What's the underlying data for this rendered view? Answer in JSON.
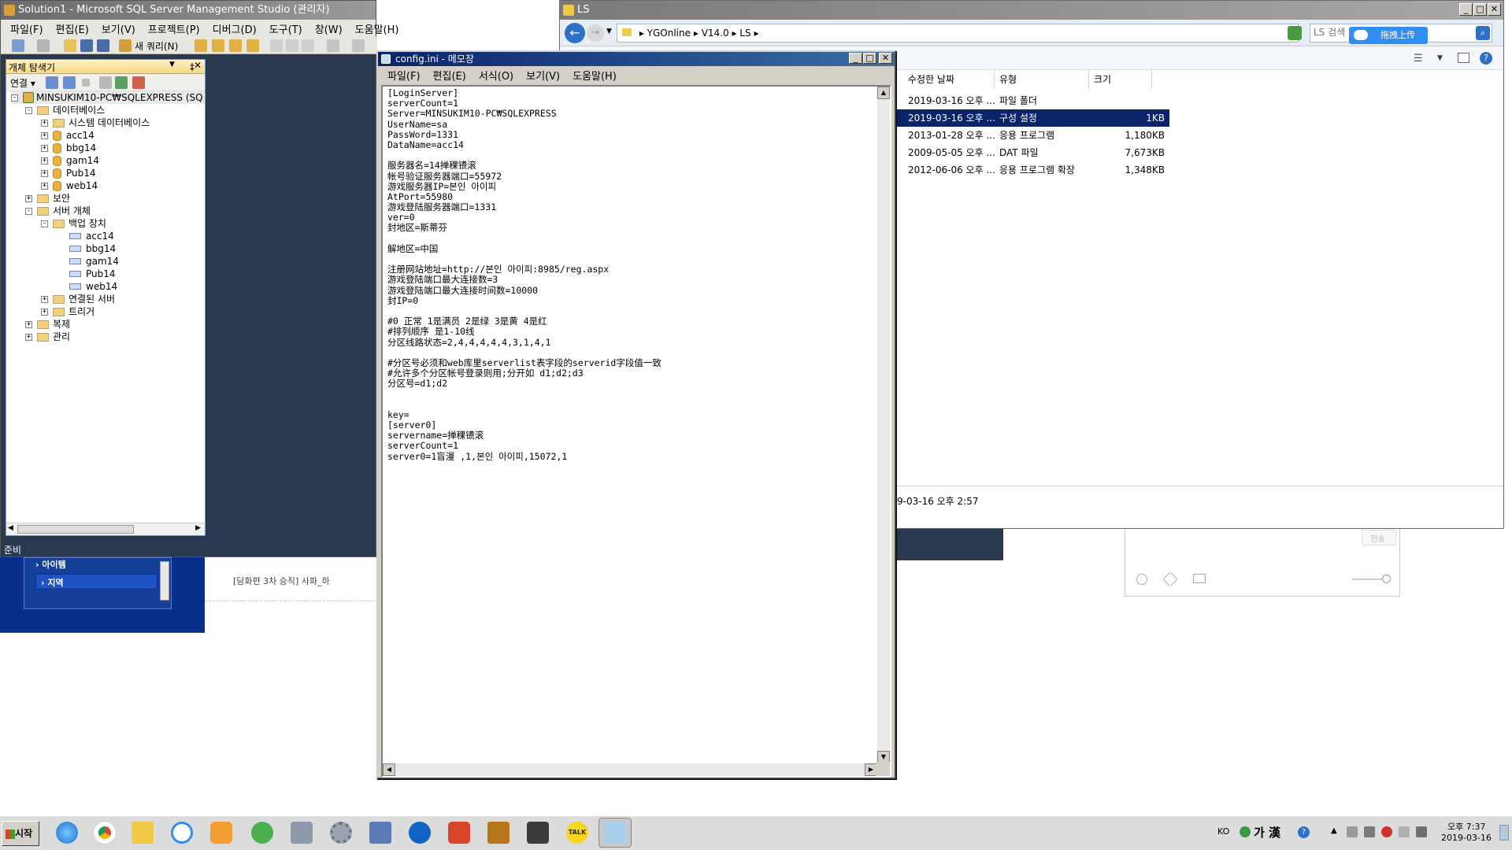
{
  "ssms": {
    "title": "Solution1 - Microsoft SQL Server Management Studio (관리자)",
    "menu": [
      "파일(F)",
      "편집(E)",
      "보기(V)",
      "프로젝트(P)",
      "디버그(D)",
      "도구(T)",
      "창(W)",
      "도움말(H)"
    ],
    "new_query_label": "새 쿼리(N)",
    "status": "준비",
    "object_explorer": {
      "title": "개체 탐색기",
      "pin": "ᅟ",
      "connect_label": "연결",
      "server": "MINSUKIM10-PC₩SQLEXPRESS (SQ",
      "nodes": {
        "databases": "데이터베이스",
        "system_databases": "시스템 데이터베이스",
        "dbs": [
          "acc14",
          "bbg14",
          "gam14",
          "Pub14",
          "web14"
        ],
        "security": "보안",
        "server_objects": "서버 개체",
        "backup_devices": "백업 장치",
        "backups": [
          "acc14",
          "bbg14",
          "gam14",
          "Pub14",
          "web14"
        ],
        "linked_servers": "연결된 서버",
        "triggers": "트리거",
        "replication": "복제",
        "management": "관리"
      }
    }
  },
  "background_web": {
    "nav_item_partial": "› 아이템",
    "nav_item_region": "› 지역",
    "post_text": "[담화편 3차 승직] 사파_하",
    "chat_send": "전송"
  },
  "notepad": {
    "title": "config.ini - 메모장",
    "menu": [
      "파일(F)",
      "편집(E)",
      "서식(O)",
      "보기(V)",
      "도움말(H)"
    ],
    "lines": [
      "[LoginServer]",
      "serverCount=1",
      "Server=MINSUKIM10-PC₩SQLEXPRESS",
      "UserName=sa",
      "PassWord=1331",
      "DataName=acc14",
      "",
      "服务器名=14掸稞镄滚",
      "帐号验证服务器端口=55972",
      "游戏服务器IP=본인 아이피",
      "AtPort=55980",
      "游戏登陆服务器端口=1331",
      "ver=0",
      "封地区=斯蒂芬",
      "",
      "解地区=中国",
      "",
      "注册网站地址=http://본인 아이피:8985/reg.aspx",
      "游戏登陆端口最大连接数=3",
      "游戏登陆端口最大连接时间数=10000",
      "封IP=0",
      "",
      "#0 正常 1是满员 2是绿 3是黄 4是红",
      "#排列顺序 是1-10线",
      "分区线路状态=2,4,4,4,4,4,3,1,4,1",
      "",
      "#分区号必须和web库里serverlist表字段的serverid字段值一致",
      "#允许多个分区帐号登录则用;分开如 d1;d2;d3",
      "分区号=d1;d2",
      "",
      "",
      "key=",
      "[server0]",
      "servername=掸稞镄滚",
      "serverCount=1",
      "server0=1盲漫 ,1,본인 아이피,15072,1"
    ]
  },
  "explorer": {
    "title": "LS",
    "breadcrumb": [
      "YGOnline",
      "V14.0",
      "LS"
    ],
    "search_placeholder": "LS 검색",
    "baidu_upload": "拖拽上传",
    "columns": [
      "수정한 날짜",
      "유형",
      "크기"
    ],
    "rows": [
      {
        "date": "2019-03-16 오후 ...",
        "type": "파일 폴더",
        "size": ""
      },
      {
        "date": "2019-03-16 오후 ...",
        "type": "구성 설정",
        "size": "1KB"
      },
      {
        "date": "2013-01-28 오후 ...",
        "type": "응용 프로그램",
        "size": "1,180KB"
      },
      {
        "date": "2009-05-05 오후 ...",
        "type": "DAT 파일",
        "size": "7,673KB"
      },
      {
        "date": "2012-06-06 오후 ...",
        "type": "응용 프로그램 확장",
        "size": "1,348KB"
      }
    ],
    "details": "9-03-16 오후 2:57"
  },
  "taskbar": {
    "start": "시작",
    "lang": "KO",
    "ime": "가 漢",
    "time": "오후 7:37",
    "date": "2019-03-16",
    "kakao": "TALK"
  },
  "colors": {
    "desktop_navy": "#2b3950",
    "title_blue": "#0a246a",
    "selection": "#0a246a",
    "web_blue": "#0c3c9c"
  }
}
